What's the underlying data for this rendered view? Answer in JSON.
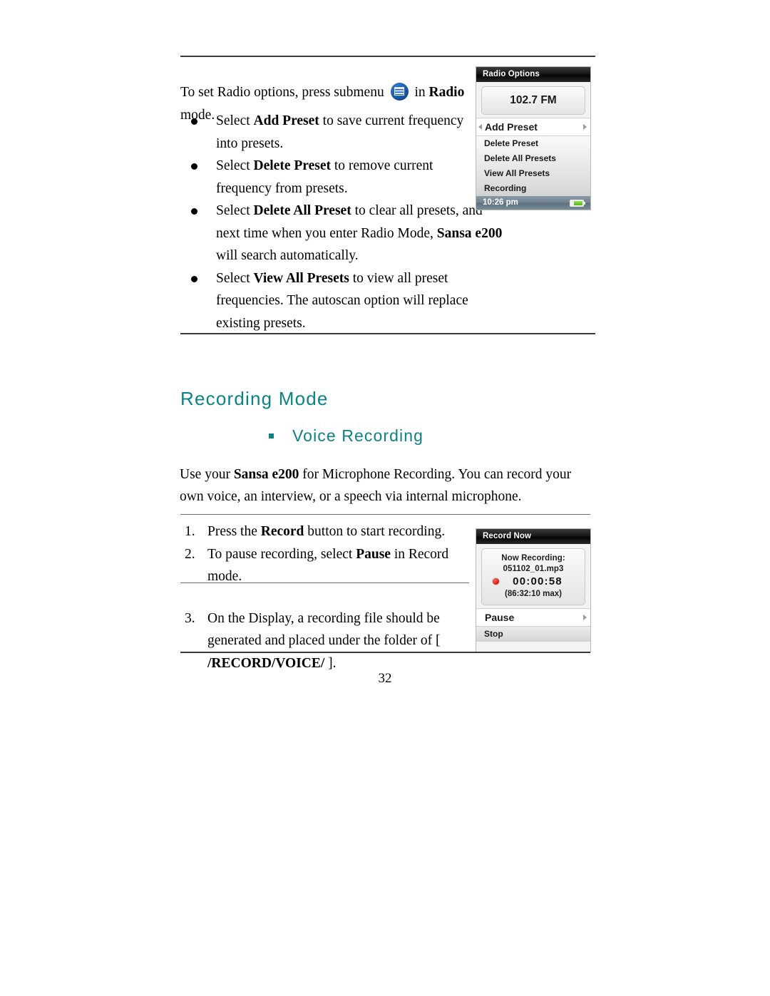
{
  "page": {
    "number": "32"
  },
  "radio_section": {
    "intro_before_icon": "To set Radio options, press submenu",
    "icon_name": "submenu-icon",
    "intro_after_icon_plain": " in ",
    "intro_after_icon_bold": "Radio",
    "intro_tail": " mode.",
    "bullets": [
      {
        "id": "add-preset",
        "parts": [
          {
            "text": "Select ",
            "bold": false
          },
          {
            "text": "Add Preset",
            "bold": true
          },
          {
            "text": " to save current frequency into presets.",
            "bold": false
          }
        ]
      },
      {
        "id": "delete-preset",
        "parts": [
          {
            "text": "Select ",
            "bold": false
          },
          {
            "text": "Delete Preset",
            "bold": true
          },
          {
            "text": " to remove current frequency from presets.",
            "bold": false
          }
        ]
      },
      {
        "id": "delete-all-preset",
        "parts": [
          {
            "text": "Select ",
            "bold": false
          },
          {
            "text": "Delete All Preset",
            "bold": true
          },
          {
            "text": " to clear all presets, and next time when you enter Radio Mode, ",
            "bold": false
          },
          {
            "text": "Sansa e200",
            "bold": true
          },
          {
            "text": " will search automatically.",
            "bold": false
          }
        ]
      },
      {
        "id": "view-all-presets",
        "parts": [
          {
            "text": "Select ",
            "bold": false
          },
          {
            "text": "View All Presets",
            "bold": true
          },
          {
            "text": " to view all preset frequencies. The autoscan option will replace existing presets.",
            "bold": false
          }
        ]
      }
    ]
  },
  "radio_device": {
    "title": "Radio Options",
    "frequency": "102.7 FM",
    "menu_items": [
      {
        "label": "Add Preset",
        "selected": true
      },
      {
        "label": "Delete Preset",
        "selected": false
      },
      {
        "label": "Delete All Presets",
        "selected": false
      },
      {
        "label": "View All Presets",
        "selected": false
      },
      {
        "label": "Recording",
        "selected": false
      }
    ],
    "status_time": "10:26 pm",
    "battery_icon": "battery-icon"
  },
  "recording_section": {
    "heading": "Recording Mode",
    "subheading": "Voice Recording",
    "paragraph_parts": [
      {
        "text": "Use your ",
        "bold": false
      },
      {
        "text": "Sansa e200",
        "bold": true
      },
      {
        "text": " for Microphone Recording.    You can record your own voice, an interview, or a speech via internal microphone.",
        "bold": false
      }
    ],
    "steps": [
      {
        "num": "1.",
        "parts": [
          {
            "text": "Press the ",
            "bold": false
          },
          {
            "text": "Record",
            "bold": true
          },
          {
            "text": " button to start recording.",
            "bold": false
          }
        ]
      },
      {
        "num": "2.",
        "parts": [
          {
            "text": "To pause recording, select ",
            "bold": false
          },
          {
            "text": "Pause",
            "bold": true
          },
          {
            "text": " in Record mode.",
            "bold": false
          }
        ]
      },
      {
        "num": "3.",
        "parts": [
          {
            "text": "On the Display, a recording file should be generated and placed under the folder of [ ",
            "bold": false
          },
          {
            "text": "/RECORD/VOICE/",
            "bold": true
          },
          {
            "text": " ].",
            "bold": false
          }
        ]
      }
    ]
  },
  "record_device": {
    "title": "Record Now",
    "now_recording_label": "Now Recording:",
    "filename": "051102_01.mp3",
    "elapsed": "00:00:58",
    "max_time": "(86:32:10 max)",
    "record_dot_icon": "record-dot-icon",
    "menu_items": [
      {
        "label": "Pause",
        "selected": true
      },
      {
        "label": "Stop",
        "selected": false
      }
    ]
  },
  "colors": {
    "heading_teal": "#0d8285",
    "rule": "#3a3a3a",
    "record_red": "#e02518",
    "battery_green": "#54b511"
  }
}
